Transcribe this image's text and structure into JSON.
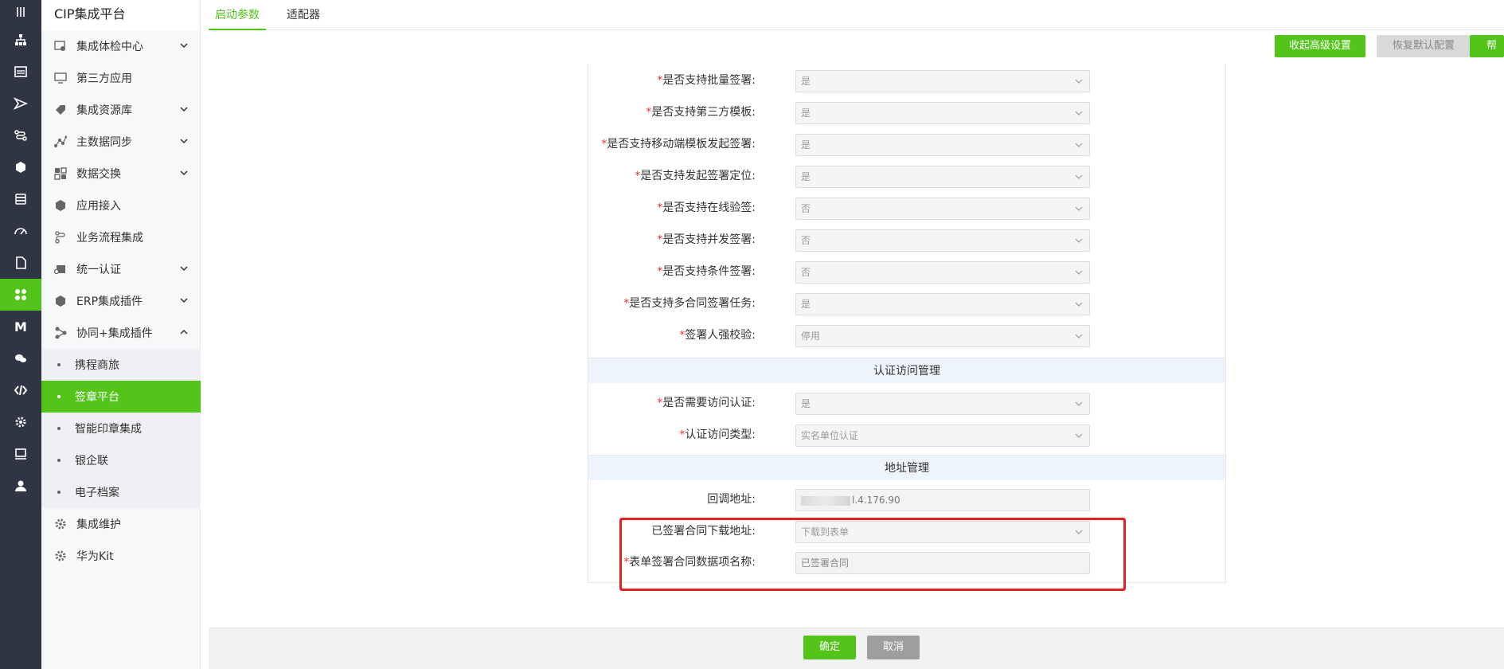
{
  "rail": {
    "items": [
      {
        "icon": "menu-icon"
      },
      {
        "icon": "org-tree-icon"
      },
      {
        "icon": "dashboard-icon"
      },
      {
        "icon": "send-icon"
      },
      {
        "icon": "flow-icon"
      },
      {
        "icon": "cip-icon"
      },
      {
        "icon": "database-icon"
      },
      {
        "icon": "speed-icon"
      },
      {
        "icon": "document-icon"
      },
      {
        "icon": "plugin-icon"
      },
      {
        "icon": "m-icon"
      },
      {
        "icon": "chat-icon"
      },
      {
        "icon": "code-icon"
      },
      {
        "icon": "settings-icon"
      },
      {
        "icon": "monitor-icon"
      },
      {
        "icon": "user-icon"
      }
    ],
    "active_index": 9,
    "accent": "#52c41a"
  },
  "sidebar": {
    "title": "CIP集成平台",
    "items": [
      {
        "label": "集成体检中心",
        "icon": "health-check-icon",
        "has_chevron": true
      },
      {
        "label": "第三方应用",
        "icon": "desktop-icon",
        "has_chevron": false
      },
      {
        "label": "集成资源库",
        "icon": "tag-icon",
        "has_chevron": true
      },
      {
        "label": "主数据同步",
        "icon": "sync-icon",
        "has_chevron": true
      },
      {
        "label": "数据交换",
        "icon": "exchange-icon",
        "has_chevron": true
      },
      {
        "label": "应用接入",
        "icon": "cube-icon",
        "has_chevron": false
      },
      {
        "label": "业务流程集成",
        "icon": "process-icon",
        "has_chevron": false
      },
      {
        "label": "统一认证",
        "icon": "auth-icon",
        "has_chevron": true
      },
      {
        "label": "ERP集成插件",
        "icon": "erp-icon",
        "has_chevron": true
      },
      {
        "label": "协同+集成插件",
        "icon": "share-icon",
        "has_chevron": true,
        "expanded": true
      }
    ],
    "sub_items": [
      {
        "label": "携程商旅"
      },
      {
        "label": "签章平台",
        "active": true
      },
      {
        "label": "智能印章集成"
      },
      {
        "label": "银企联"
      },
      {
        "label": "电子档案"
      }
    ],
    "bottom_items": [
      {
        "label": "集成维护",
        "icon": "gear-icon"
      },
      {
        "label": "华为Kit",
        "icon": "gear-icon"
      }
    ]
  },
  "tabs": [
    {
      "label": "启动参数",
      "active": true
    },
    {
      "label": "适配器",
      "active": false
    }
  ],
  "actions": {
    "advanced": "收起高级设置",
    "restore": "恢复默认配置",
    "help": "帮助"
  },
  "form": {
    "rows": [
      {
        "label": "是否支持批量签署:",
        "required": true,
        "value": "是",
        "type": "select"
      },
      {
        "label": "是否支持第三方模板:",
        "required": true,
        "value": "是",
        "type": "select"
      },
      {
        "label": "是否支持移动端模板发起签署:",
        "required": true,
        "value": "是",
        "type": "select"
      },
      {
        "label": "是否支持发起签署定位:",
        "required": true,
        "value": "是",
        "type": "select"
      },
      {
        "label": "是否支持在线验签:",
        "required": true,
        "value": "否",
        "type": "select"
      },
      {
        "label": "是否支持并发签署:",
        "required": true,
        "value": "否",
        "type": "select"
      },
      {
        "label": "是否支持条件签署:",
        "required": true,
        "value": "否",
        "type": "select"
      },
      {
        "label": "是否支持多合同签署任务:",
        "required": true,
        "value": "是",
        "type": "select"
      },
      {
        "label": "签署人强校验:",
        "required": true,
        "value": "停用",
        "type": "select"
      }
    ],
    "section_auth": "认证访问管理",
    "auth_rows": [
      {
        "label": "是否需要访问认证:",
        "required": true,
        "value": "是",
        "type": "select"
      },
      {
        "label": "认证访问类型:",
        "required": true,
        "value": "实名单位认证",
        "type": "select"
      }
    ],
    "section_address": "地址管理",
    "address_rows": [
      {
        "label": "回调地址:",
        "required": false,
        "value": "l.4.176.90",
        "type": "input"
      },
      {
        "label": "已签署合同下载地址:",
        "required": false,
        "value": "下载到表单",
        "type": "select"
      },
      {
        "label": "表单签署合同数据项名称:",
        "required": true,
        "value": "已签署合同",
        "type": "input"
      }
    ]
  },
  "footer": {
    "confirm": "确定",
    "cancel": "取消"
  }
}
